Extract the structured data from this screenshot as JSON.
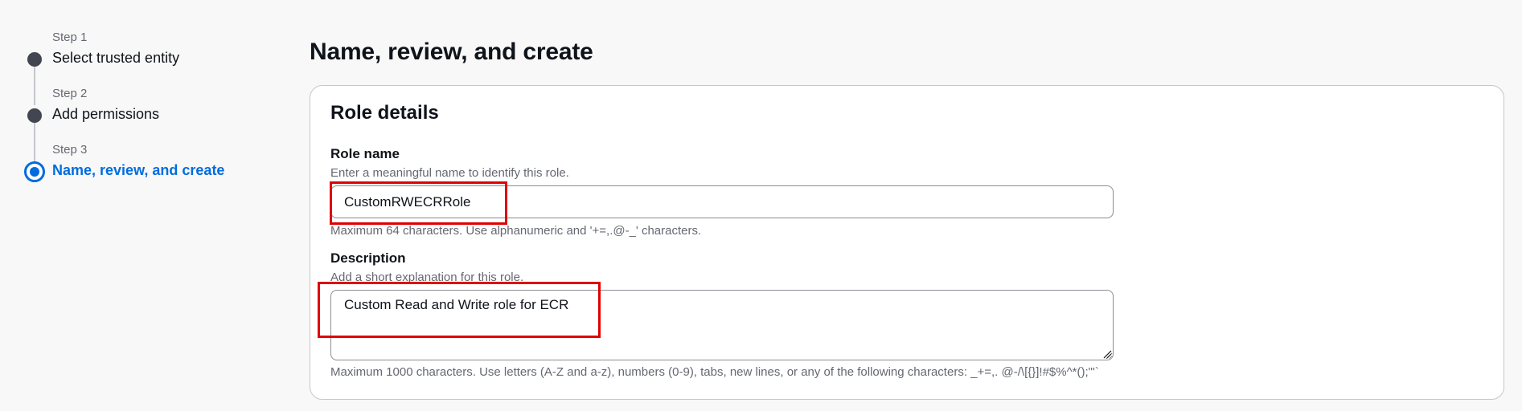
{
  "stepper": {
    "steps": [
      {
        "caption": "Step 1",
        "title": "Select trusted entity",
        "state": "completed"
      },
      {
        "caption": "Step 2",
        "title": "Add permissions",
        "state": "completed"
      },
      {
        "caption": "Step 3",
        "title": "Name, review, and create",
        "state": "active"
      }
    ]
  },
  "page": {
    "title": "Name, review, and create"
  },
  "role_details": {
    "title": "Role details",
    "role_name": {
      "label": "Role name",
      "description": "Enter a meaningful name to identify this role.",
      "value": "CustomRWECRRole",
      "constraint": "Maximum 64 characters. Use alphanumeric and '+=,.@-_' characters."
    },
    "description": {
      "label": "Description",
      "description": "Add a short explanation for this role.",
      "value": "Custom Read and Write role for ECR",
      "constraint": "Maximum 1000 characters. Use letters (A-Z and a-z), numbers (0-9), tabs, new lines, or any of the following characters: _+=,. @-/\\[{}]!#$%^*();\"'`"
    }
  },
  "colors": {
    "accent": "#006ce0",
    "completed_step": "#424650",
    "highlight": "#e00000",
    "background": "#f8f8f8"
  }
}
